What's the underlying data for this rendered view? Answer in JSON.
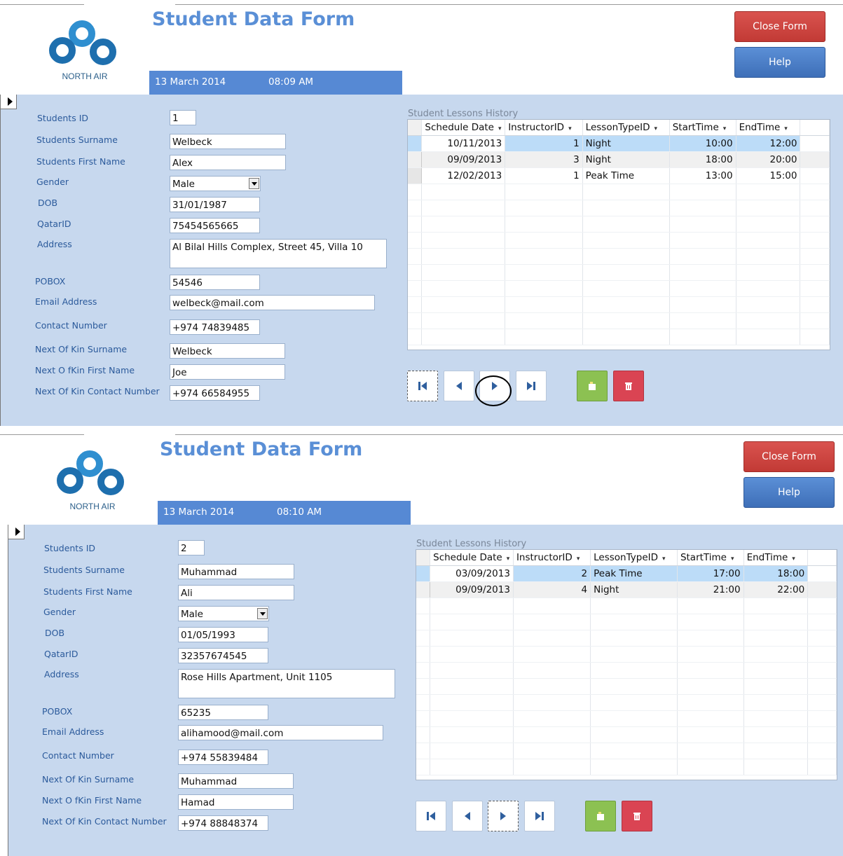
{
  "logo_text": "NORTH AIR",
  "labels": {
    "student_id": "Students ID",
    "surname": "Students Surname",
    "first_name": "Students First Name",
    "gender": "Gender",
    "dob": "DOB",
    "qatar_id": "QatarID",
    "address": "Address",
    "pobox": "POBOX",
    "email": "Email Address",
    "contact": "Contact Number",
    "kin_surname": "Next Of Kin Surname",
    "kin_first": "Next O fKin First Name",
    "kin_contact": "Next Of Kin Contact Number"
  },
  "grid_headers": {
    "schedule": "Schedule Date",
    "instructor": "InstructorID",
    "lesson": "LessonTypeID",
    "start": "StartTime",
    "end": "EndTime",
    "sort_arrow": "▾"
  },
  "colors": {
    "accent": "#5689d4",
    "background": "#c7d8ee",
    "close": "#d9534f",
    "help": "#4a7fc6",
    "add": "#8cc152",
    "delete": "#da4453"
  },
  "screens": [
    {
      "title": "Student Data Form",
      "date": "13 March 2014",
      "time": "08:09 AM",
      "close_label": "Close Form",
      "help_label": "Help",
      "subform_title": "Student Lessons History",
      "fields": {
        "student_id": "1",
        "surname": "Welbeck",
        "first_name": "Alex",
        "gender": "Male",
        "dob": "31/01/1987",
        "qatar_id": "75454565665",
        "address": "Al Bilal Hills Complex, Street 45, Villa 10",
        "pobox": "54546",
        "email": "welbeck@mail.com",
        "contact": "+974 74839485",
        "kin_surname": "Welbeck",
        "kin_first": "Joe",
        "kin_contact": "+974 66584955"
      },
      "lessons": [
        {
          "schedule": "10/11/2013",
          "instructor": "1",
          "lesson": "Night",
          "start": "10:00",
          "end": "12:00"
        },
        {
          "schedule": "09/09/2013",
          "instructor": "3",
          "lesson": "Night",
          "start": "18:00",
          "end": "20:00"
        },
        {
          "schedule": "12/02/2013",
          "instructor": "1",
          "lesson": "Peak Time",
          "start": "13:00",
          "end": "15:00"
        }
      ]
    },
    {
      "title": "Student Data Form",
      "date": "13 March 2014",
      "time": "08:10 AM",
      "close_label": "Close Form",
      "help_label": "Help",
      "subform_title": "Student Lessons History",
      "fields": {
        "student_id": "2",
        "surname": "Muhammad",
        "first_name": "Ali",
        "gender": "Male",
        "dob": "01/05/1993",
        "qatar_id": "32357674545",
        "address": "Rose Hills Apartment, Unit 1105",
        "pobox": "65235",
        "email": "alihamood@mail.com",
        "contact": "+974 55839484",
        "kin_surname": "Muhammad",
        "kin_first": "Hamad",
        "kin_contact": "+974 88848374"
      },
      "lessons": [
        {
          "schedule": "03/09/2013",
          "instructor": "2",
          "lesson": "Peak Time",
          "start": "17:00",
          "end": "18:00"
        },
        {
          "schedule": "09/09/2013",
          "instructor": "4",
          "lesson": "Night",
          "start": "21:00",
          "end": "22:00"
        }
      ]
    }
  ]
}
